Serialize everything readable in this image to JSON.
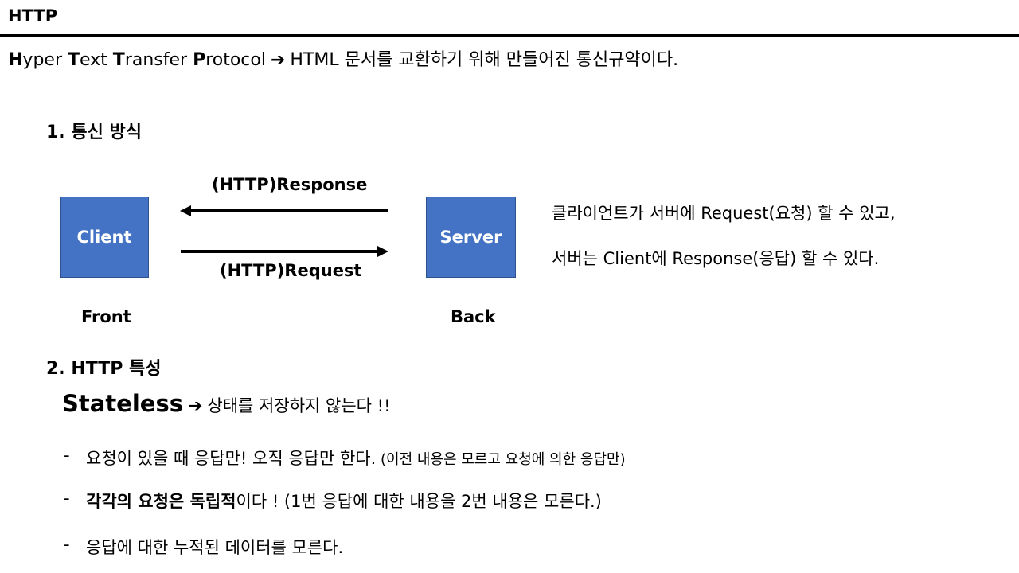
{
  "header": {
    "title": "HTTP"
  },
  "definition": {
    "h_letter": "H",
    "h_rest": "yper ",
    "t_letter": "T",
    "t_rest": "ext ",
    "tr_letter": "T",
    "tr_rest": "ransfer ",
    "p_letter": "P",
    "p_rest": "rotocol",
    "arrow": "➔",
    "meaning": "HTML 문서를 교환하기 위해 만들어진 통신규약이다."
  },
  "section1": {
    "heading": "1. 통신 방식",
    "client_label": "Client",
    "server_label": "Server",
    "response_label": "(HTTP)Response",
    "request_label": "(HTTP)Request",
    "front_label": "Front",
    "back_label": "Back",
    "description_line1": "클라이언트가 서버에 Request(요청) 할 수 있고,",
    "description_line2": "서버는 Client에 Response(응답) 할 수 있다."
  },
  "section2": {
    "heading": "2. HTTP 특성",
    "stateless_word": "Stateless",
    "arrow": "➔",
    "stateless_meaning": "상태를 저장하지 않는다 !!",
    "bullets": [
      {
        "dash": "-",
        "text": "요청이 있을 때 응답만! 오직 응답만 한다.",
        "note": " (이전 내용은 모르고 요청에 의한 응답만)"
      },
      {
        "dash": "-",
        "emph": "각각의 요청은 독립적",
        "text": "이다 ! (1번 응답에 대한 내용을 2번 내용은 모른다.)"
      },
      {
        "dash": "-",
        "text": "응답에 대한 누적된 데이터를 모른다."
      }
    ]
  },
  "colors": {
    "box_fill": "#4472c4",
    "box_border": "#2f528f",
    "box_text": "#ffffff",
    "arrow": "#000000"
  }
}
